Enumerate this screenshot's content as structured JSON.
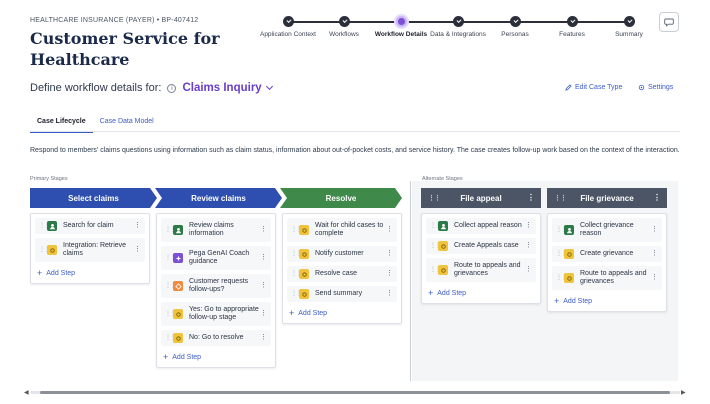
{
  "header": {
    "breadcrumb": "HEALTHCARE INSURANCE (PAYER) • BP-407412",
    "title": "Customer Service for Healthcare"
  },
  "stepper": {
    "steps": [
      {
        "label": "Application Context",
        "state": "done"
      },
      {
        "label": "Workflows",
        "state": "done"
      },
      {
        "label": "Workflow Details",
        "state": "active"
      },
      {
        "label": "Data & Integrations",
        "state": "todo"
      },
      {
        "label": "Personas",
        "state": "todo"
      },
      {
        "label": "Features",
        "state": "todo"
      },
      {
        "label": "Summary",
        "state": "todo"
      }
    ]
  },
  "define": {
    "prefix": "Define workflow details for:",
    "case_type": "Claims Inquiry",
    "edit_case_type": "Edit Case Type",
    "settings": "Settings"
  },
  "tabs": [
    "Case Lifecycle",
    "Case Data Model"
  ],
  "description": "Respond to members' claims questions using information such as claim status, information about out-of-pocket costs, and service history. The case creates follow-up work based on the context of the interaction.",
  "labels": {
    "primary_stages": "Primary Stages",
    "alternate_stages": "Alternate Stages",
    "add_step": "Add Step"
  },
  "colors": {
    "primary_blue": "#2f4fb0",
    "resolve_green": "#3f8a4a",
    "alternate_gray": "#4b5566",
    "accent_purple": "#6a3fc9",
    "link_blue": "#3b5cc7"
  },
  "stages": [
    {
      "name": "Select claims",
      "kind": "primary",
      "steps": [
        {
          "label": "Search for claim",
          "icon": "user-icon"
        },
        {
          "label": "Integration: Retrieve claims",
          "icon": "integration-icon"
        }
      ]
    },
    {
      "name": "Review claims",
      "kind": "primary",
      "steps": [
        {
          "label": "Review claims information",
          "icon": "user-icon"
        },
        {
          "label": "Pega GenAI Coach guidance",
          "icon": "genai-icon"
        },
        {
          "label": "Customer requests follow-ups?",
          "icon": "decision-icon"
        },
        {
          "label": "Yes: Go to appropriate follow-up stage",
          "icon": "automation-icon"
        },
        {
          "label": "No: Go to resolve",
          "icon": "automation-icon"
        }
      ]
    },
    {
      "name": "Resolve",
      "kind": "resolve",
      "steps": [
        {
          "label": "Wait for child cases to complete",
          "icon": "automation-icon"
        },
        {
          "label": "Notify customer",
          "icon": "automation-icon"
        },
        {
          "label": "Resolve case",
          "icon": "automation-icon"
        },
        {
          "label": "Send summary",
          "icon": "automation-icon"
        }
      ]
    },
    {
      "name": "File appeal",
      "kind": "alternate",
      "steps": [
        {
          "label": "Collect appeal reason",
          "icon": "user-icon"
        },
        {
          "label": "Create Appeals case",
          "icon": "automation-icon"
        },
        {
          "label": "Route to appeals and grievances",
          "icon": "automation-icon"
        }
      ]
    },
    {
      "name": "File grievance",
      "kind": "alternate",
      "steps": [
        {
          "label": "Collect grievance reason",
          "icon": "user-icon"
        },
        {
          "label": "Create grievance",
          "icon": "automation-icon"
        },
        {
          "label": "Route to appeals and grievances",
          "icon": "automation-icon"
        }
      ]
    }
  ]
}
